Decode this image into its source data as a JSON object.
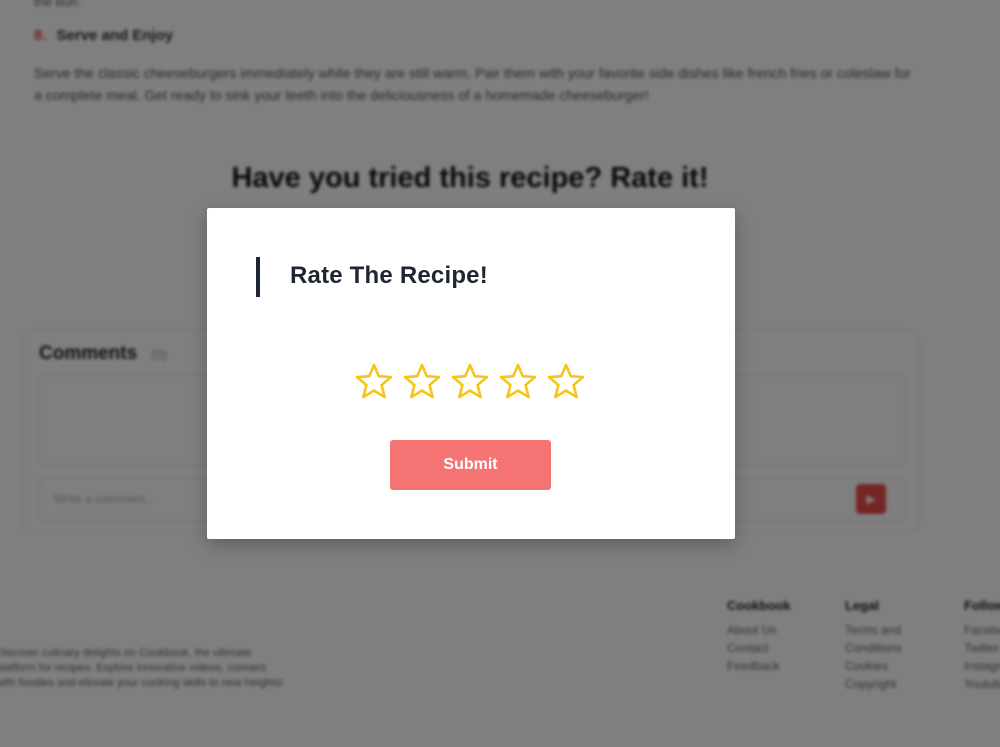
{
  "background": {
    "cut_text": "the bun.",
    "step": {
      "number": "8.",
      "title": "Serve and Enjoy"
    },
    "step_body": "Serve the classic cheeseburgers immediately while they are still warm. Pair them with your favorite side dishes like french fries or coleslaw for a complete meal. Get ready to sink your teeth into the deliciousness of a homemade cheeseburger!",
    "rate_heading": "Have you tried this recipe? Rate it!",
    "comments": {
      "title": "Comments",
      "count": "(0)",
      "input_placeholder": "Write a comment...",
      "send_icon": "send-icon"
    },
    "footer": {
      "about": "Discover culinary delights on Cookbook, the ultimate platform for recipes. Explore innovative videos, connect with foodies and elevate your cooking skills to new heights!",
      "columns": [
        {
          "heading": "Cookbook",
          "links": [
            "About Us",
            "Contact",
            "Feedback"
          ]
        },
        {
          "heading": "Legal",
          "links": [
            "Terms and",
            "Conditions",
            "Cookies",
            "Copyright"
          ]
        },
        {
          "heading": "Follow",
          "links": [
            "Facebook",
            "Twitter",
            "Instagram",
            "Youtube"
          ]
        }
      ]
    }
  },
  "modal": {
    "title": "Rate The Recipe!",
    "rating": {
      "value": 0,
      "max": 5,
      "star_icon": "star-outline-icon",
      "star_color": "#f5c518"
    },
    "submit_label": "Submit",
    "submit_color": "#f47373",
    "accent_color": "#1f2633"
  }
}
